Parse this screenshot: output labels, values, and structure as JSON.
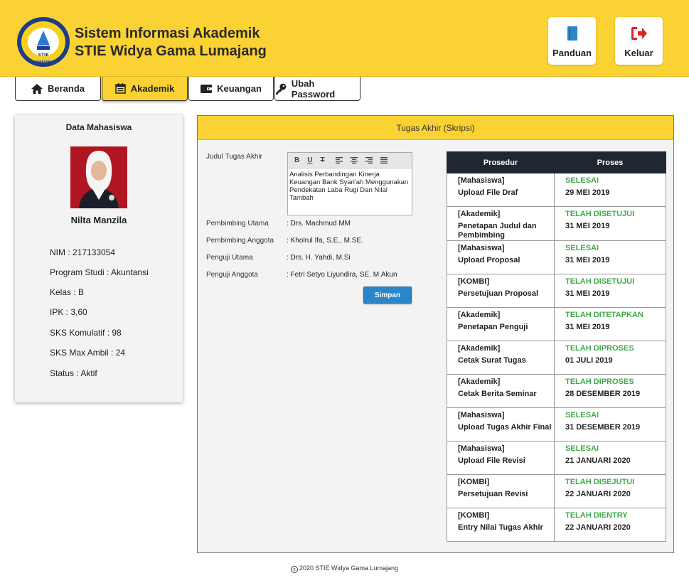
{
  "header": {
    "title_line1": "Sistem Informasi Akademik",
    "title_line2": "STIE Widya Gama Lumajang",
    "logo_text_top": "SEKOLAH TINGGI ILMU EKONOMI WIDYA GAMA",
    "logo_text_bottom": "LUMAJANG",
    "logo_center": "STIE",
    "buttons": {
      "panduan": "Panduan",
      "keluar": "Keluar"
    },
    "colors": {
      "brand": "#fbd233",
      "keluar_icon": "#d8232a",
      "panduan_icon": "#2c85c9"
    }
  },
  "nav": {
    "tabs": [
      {
        "label": "Beranda",
        "icon": "home-icon"
      },
      {
        "label": "Akademik",
        "icon": "calendar-icon",
        "active": true
      },
      {
        "label": "Keuangan",
        "icon": "wallet-icon"
      },
      {
        "label": "Ubah Password",
        "icon": "key-icon"
      }
    ]
  },
  "student": {
    "card_title": "Data Mahasiswa",
    "name": "Nilta Manzila",
    "nim": "NIM : 217133054",
    "program": "Program Studi : Akuntansi",
    "kelas": "Kelas : B",
    "ipk": "IPK : 3,60",
    "sks_kumulatif": "SKS Komulatif : 98",
    "sks_max": "SKS Max Ambil : 24",
    "status": "Status : Aktif"
  },
  "thesis": {
    "panel_title": "Tugas Akhir (Skripsi)",
    "judul_label": "Judul Tugas Akhir",
    "judul_value": "Analisis Perbandingan Kinerja Keuangan Bank Syari'ah Menggunakan Pendekatan Laba Rugi Dan Nilai Tambah",
    "toolbar": [
      "B",
      "U",
      "T"
    ],
    "pembimbing_utama_label": "Pembimbing Utama",
    "pembimbing_utama": ": Drs. Machmud MM",
    "pembimbing_anggota_label": "Pembimbing Anggota",
    "pembimbing_anggota": ": Kholrul Ifa, S.E., M.SE.",
    "penguji_utama_label": "Penguji Utama",
    "penguji_utama": ": Drs. H. Yahdi, M.Si",
    "penguji_anggota_label": "Penguji Anggota",
    "penguji_anggota": ": Fetri Setyo Liyundira, SE. M.Akun",
    "save_label": "Simpan"
  },
  "table": {
    "headers": [
      "Prosedur",
      "Proses"
    ],
    "rows": [
      {
        "role": "[Mahasiswa]",
        "step": "Upload File Draf",
        "status": "SELESAI",
        "date": "29 MEI 2019"
      },
      {
        "role": "[Akademik]",
        "step": "Penetapan Judul dan Pembimbing",
        "status": "TELAH DISETUJUI",
        "date": "31 MEI 2019"
      },
      {
        "role": "[Mahasiswa]",
        "step": "Upload Proposal",
        "status": "SELESAI",
        "date": "31 MEI 2019"
      },
      {
        "role": "[KOMBI]",
        "step": "Persetujuan Proposal",
        "status": "TELAH DISETUJUI",
        "date": "31 MEI 2019"
      },
      {
        "role": "[Akademik]",
        "step": "Penetapan Penguji",
        "status": "TELAH DITETAPKAN",
        "date": "31 MEI 2019"
      },
      {
        "role": "[Akademik]",
        "step": "Cetak Surat Tugas",
        "status": "TELAH DIPROSES",
        "date": "01 JULI 2019"
      },
      {
        "role": "[Akademik]",
        "step": "Cetak Berita Seminar",
        "status": "TELAH DIPROSES",
        "date": "28 DESEMBER 2019"
      },
      {
        "role": "[Mahasiswa]",
        "step": "Upload Tugas Akhir Final",
        "status": "SELESAI",
        "date": "31 DESEMBER 2019"
      },
      {
        "role": "[Mahasiswa]",
        "step": "Upload File Revisi",
        "status": "SELESAI",
        "date": "21 JANUARI 2020"
      },
      {
        "role": "[KOMBI]",
        "step": "Persetujuan Revisi",
        "status": "TELAH DISEJUTUI",
        "date": "22 JANUARI 2020"
      },
      {
        "role": "[KOMBI]",
        "step": "Entry Nilai Tugas Akhir",
        "status": "TELAH DIENTRY",
        "date": "22 JANUARI 2020"
      }
    ],
    "status_color": "#3dab4a"
  },
  "footer": {
    "text": "2020 STIE Widya Gama Lumajang"
  }
}
